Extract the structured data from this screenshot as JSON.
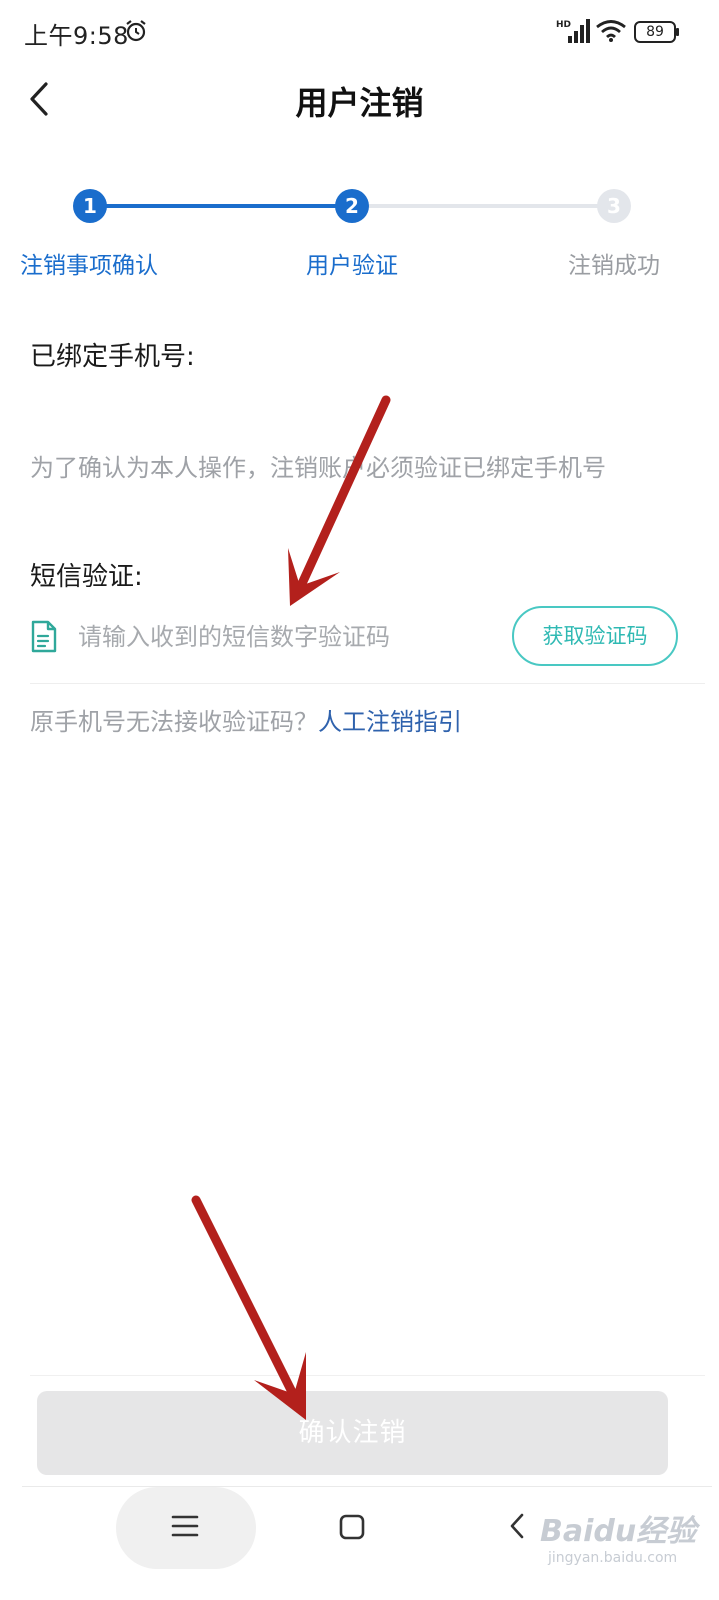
{
  "status_bar": {
    "time": "上午9:58",
    "battery": "89",
    "network": "HD"
  },
  "header": {
    "title": "用户注销"
  },
  "stepper": {
    "steps": [
      {
        "number": "1",
        "label": "注销事项确认",
        "state": "done"
      },
      {
        "number": "2",
        "label": "用户验证",
        "state": "active"
      },
      {
        "number": "3",
        "label": "注销成功",
        "state": "inactive"
      }
    ]
  },
  "content": {
    "bound_phone_label": "已绑定手机号:",
    "hint": "为了确认为本人操作，注销账户必须验证已绑定手机号",
    "sms_label": "短信验证:",
    "sms_placeholder": "请输入收到的短信数字验证码",
    "get_code_label": "获取验证码",
    "help_question": "原手机号无法接收验证码？",
    "help_link": "人工注销指引"
  },
  "footer": {
    "confirm_label": "确认注销"
  },
  "watermark": {
    "logo": "Baidu经验",
    "sub": "jingyan.baidu.com"
  },
  "colors": {
    "primary": "#1a6dcc",
    "teal": "#2fb9b3",
    "link": "#2f62ad",
    "annotation_arrow": "#b3201c"
  }
}
